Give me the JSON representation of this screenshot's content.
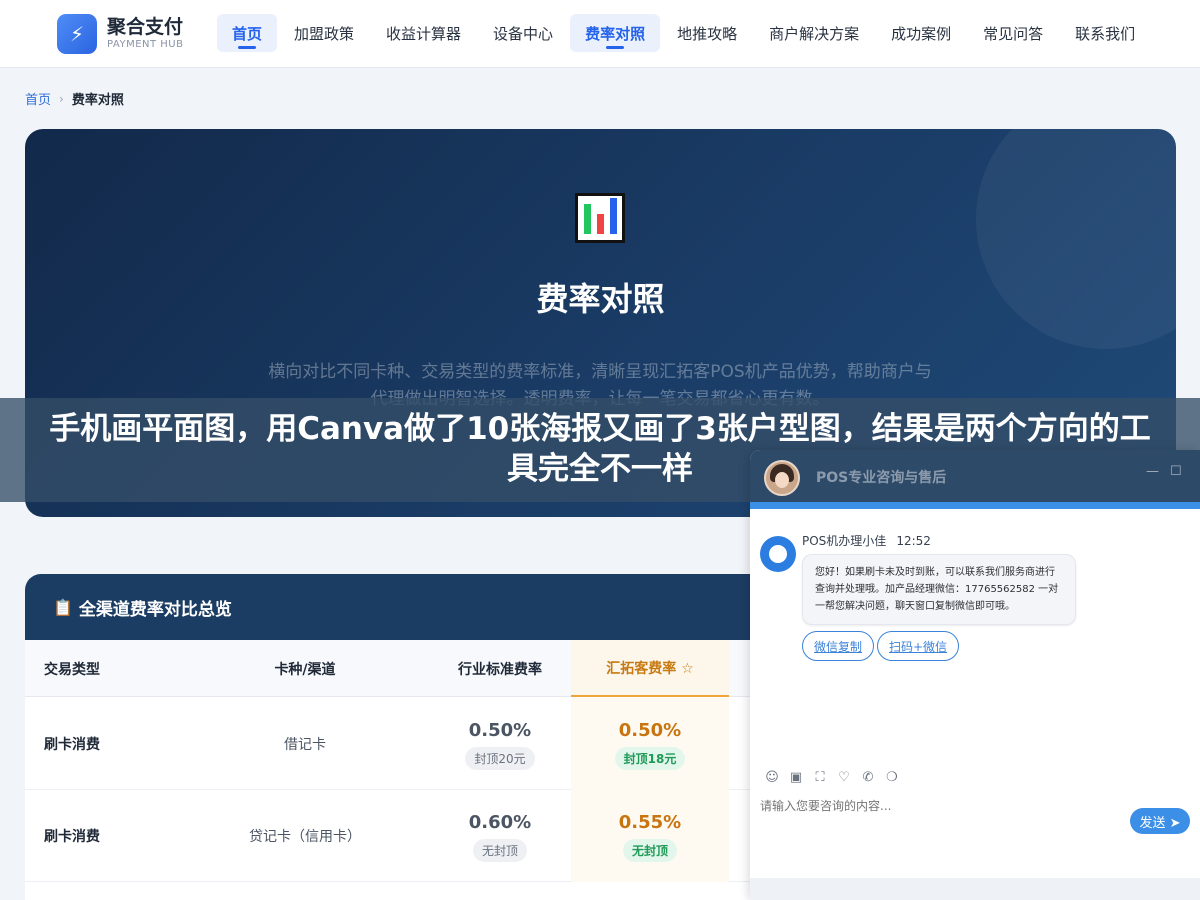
{
  "header": {
    "logo_mark": "⚡",
    "logo_name": "聚合支付",
    "logo_sub": "PAYMENT HUB",
    "nav": [
      {
        "label": "首页",
        "active": true
      },
      {
        "label": "加盟政策"
      },
      {
        "label": "收益计算器"
      },
      {
        "label": "设备中心"
      },
      {
        "label": "费率对照",
        "active": true
      },
      {
        "label": "地推攻略"
      },
      {
        "label": "商户解决方案"
      },
      {
        "label": "成功案例"
      },
      {
        "label": "常见问答"
      },
      {
        "label": "联系我们"
      }
    ]
  },
  "breadcrumb": {
    "home": "首页",
    "separator": "›",
    "current": "费率对照"
  },
  "hero": {
    "title": "费率对照",
    "description": "横向对比不同卡种、交易类型的费率标准，清晰呈现汇拓客POS机产品优势，帮助商户与代理做出明智选择。透明费率，让每一笔交易都省心更有数。"
  },
  "overlay": {
    "headline": "手机画平面图，用Canva做了10张海报又画了3张户型图，结果是两个方向的工具完全不一样"
  },
  "table_card": {
    "title": "全渠道费率对比总览",
    "title_icon": "📋",
    "columns": [
      "交易类型",
      "卡种/渠道",
      "行业标准费率",
      "汇拓客费率 ☆"
    ],
    "rows": [
      {
        "type": "刷卡消费",
        "card": "借记卡",
        "std_rate": "0.50%",
        "std_tag": "封顶20元",
        "our_rate": "0.50%",
        "our_tag": "封顶18元"
      },
      {
        "type": "刷卡消费",
        "card": "贷记卡（信用卡）",
        "std_rate": "0.60%",
        "std_tag": "无封顶",
        "our_rate": "0.55%",
        "our_tag": "无封顶"
      }
    ]
  },
  "chat": {
    "title": "POS专业咨询与售后",
    "minimize": "—",
    "maximize": "☐",
    "agent_name": "POS机办理小佳",
    "time": "12:52",
    "message": "您好！如果刷卡未及时到账，可以联系我们服务商进行查询并处理哦。加产品经理微信：17765562582 一对一帮您解决问题，聊天窗口复制微信即可哦。",
    "chips": [
      "微信复制",
      "扫码+微信"
    ],
    "tools": [
      "☺",
      "▣",
      "⛶",
      "♡",
      "✆",
      "❍"
    ],
    "input_placeholder": "请输入您要咨询的内容...",
    "send_label": "发送 ➤"
  }
}
